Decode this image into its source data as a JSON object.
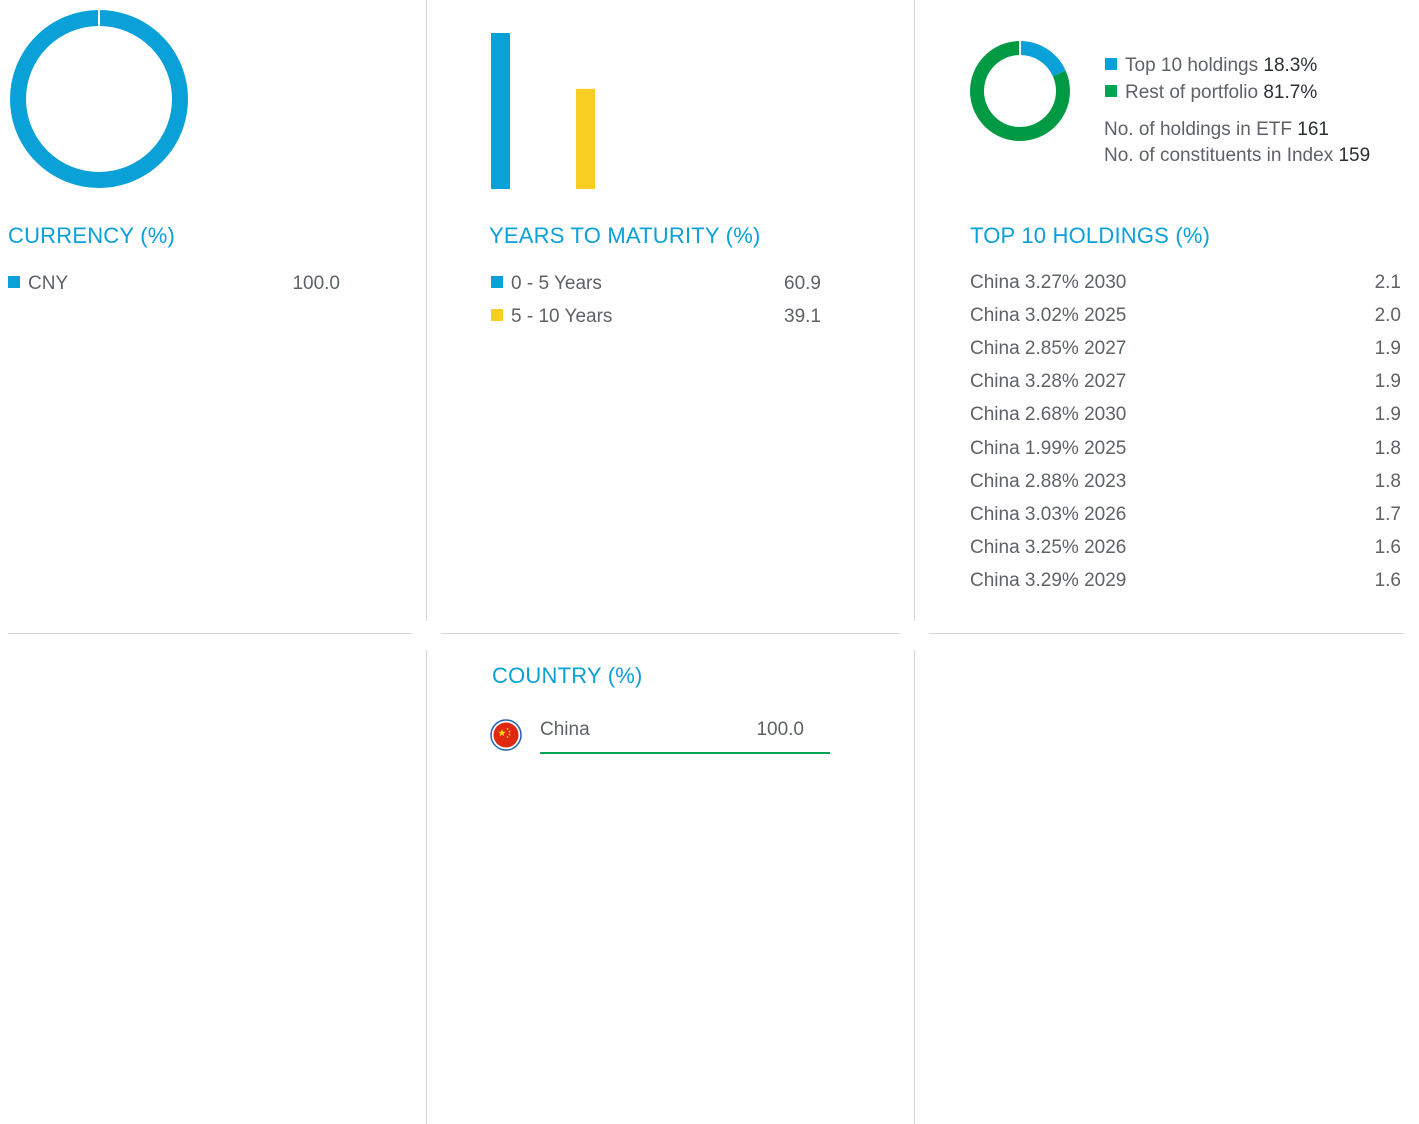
{
  "currency": {
    "heading": "CURRENCY (%)",
    "chart_data": {
      "type": "pie",
      "categories": [
        "CNY"
      ],
      "values": [
        100.0
      ],
      "colors": [
        "#0aa0d8"
      ]
    },
    "items": [
      {
        "label": "CNY",
        "value": "100.0",
        "color": "#0aa0d8"
      }
    ]
  },
  "maturity": {
    "heading": "YEARS TO MATURITY (%)",
    "chart_data": {
      "type": "bar",
      "categories": [
        "0 - 5 Years",
        "5 - 10 Years"
      ],
      "values": [
        60.9,
        39.1
      ],
      "colors": [
        "#0aa0d8",
        "#f9ce23"
      ],
      "ylim": [
        0,
        60.9
      ]
    },
    "items": [
      {
        "label": "0 - 5 Years",
        "value": "60.9",
        "color": "#0aa0d8"
      },
      {
        "label": "5 - 10 Years",
        "value": "39.1",
        "color": "#f9ce23"
      }
    ]
  },
  "holdings": {
    "heading": "TOP 10 HOLDINGS (%)",
    "chart_data": {
      "type": "pie",
      "categories": [
        "Top 10 holdings",
        "Rest of portfolio"
      ],
      "values": [
        18.3,
        81.7
      ],
      "colors": [
        "#0aa0d8",
        "#009a44"
      ]
    },
    "legend": [
      {
        "label": "Top 10 holdings",
        "value": "18.3%",
        "color": "#0aa0d8"
      },
      {
        "label": "Rest of portfolio",
        "value": "81.7%",
        "color": "#00a651"
      }
    ],
    "count_etf_label": "No. of holdings in ETF",
    "count_etf": "161",
    "count_index_label": "No. of constituents in Index",
    "count_index": "159",
    "rows": [
      {
        "name": "China 3.27% 2030",
        "value": "2.1"
      },
      {
        "name": "China 3.02% 2025",
        "value": "2.0"
      },
      {
        "name": "China 2.85% 2027",
        "value": "1.9"
      },
      {
        "name": "China 3.28% 2027",
        "value": "1.9"
      },
      {
        "name": "China 2.68% 2030",
        "value": "1.9"
      },
      {
        "name": "China 1.99% 2025",
        "value": "1.8"
      },
      {
        "name": "China 2.88% 2023",
        "value": "1.8"
      },
      {
        "name": "China 3.03% 2026",
        "value": "1.7"
      },
      {
        "name": "China 3.25% 2026",
        "value": "1.6"
      },
      {
        "name": "China 3.29% 2029",
        "value": "1.6"
      }
    ]
  },
  "country": {
    "heading": "COUNTRY (%)",
    "items": [
      {
        "label": "China",
        "value": "100.0",
        "flag_icon": "china-flag-icon",
        "bar_color": "#00a651"
      }
    ]
  }
}
